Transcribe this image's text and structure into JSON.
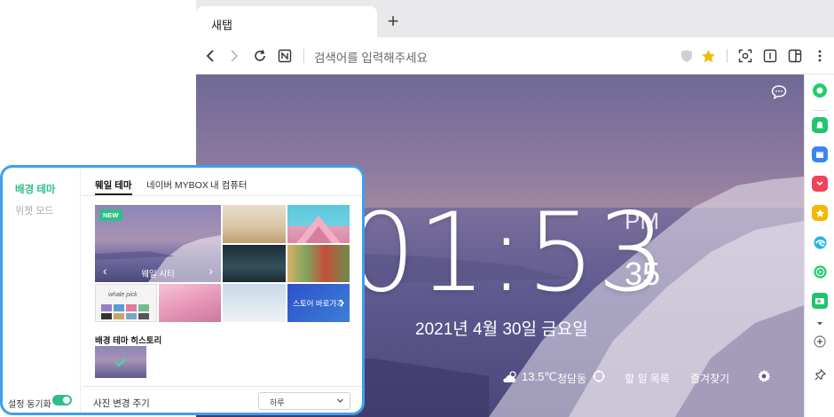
{
  "browser": {
    "tab_title": "새탭",
    "new_tab_symbol": "+",
    "address_placeholder": "검색어를 입력해주세요"
  },
  "clock": {
    "time": "01:53",
    "ampm": "PM",
    "seconds": "35",
    "date": "2021년 4월 30일 금요일"
  },
  "bottom_bar": {
    "temperature": "13.5℃",
    "location": "청담동",
    "todo_label": "할 일 목록",
    "favorites_label": "즐겨찾기"
  },
  "panel": {
    "menu": {
      "background_theme": "배경 테마",
      "widget_mode": "위젯 모드"
    },
    "sync_label": "설정 동기화",
    "sync_enabled": true,
    "tabs": [
      {
        "label": "웨일 테마"
      },
      {
        "label": "네이버 MYBOX"
      },
      {
        "label": "내 컴퓨터"
      }
    ],
    "featured_badge": "NEW",
    "featured_title": "웨일 시티",
    "whale_pick_label": "whale pick",
    "store_link": "스토어 바로가기",
    "history_title": "배경 테마 히스토리",
    "photo_period_label": "사진 변경 주기",
    "photo_period_value": "하루"
  },
  "colors": {
    "accent_green": "#2fbf86",
    "panel_border_blue": "#3ca0ec",
    "star_yellow": "#f5b800"
  }
}
